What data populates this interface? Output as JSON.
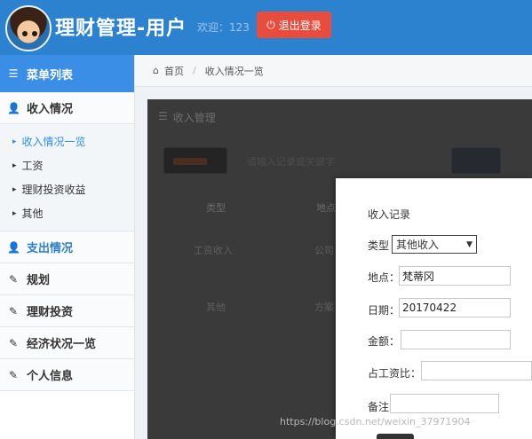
{
  "header": {
    "app_title": "理财管理-用户",
    "welcome": "欢迎：123",
    "logout_label": "退出登录",
    "bg_color": "#2d82cf",
    "logout_color": "#e74c3c"
  },
  "sidebar": {
    "menu_title": "菜单列表",
    "sections": [
      {
        "label": "收入情况",
        "icon": "user-icon"
      },
      {
        "label": "支出情况",
        "icon": "user-icon"
      },
      {
        "label": "规划",
        "icon": "edit-icon"
      },
      {
        "label": "理财投资",
        "icon": "edit-icon"
      },
      {
        "label": "经济状况一览",
        "icon": "edit-icon"
      },
      {
        "label": "个人信息",
        "icon": "edit-icon"
      }
    ],
    "income_sub": [
      "收入情况一览",
      "工资",
      "理财投资收益",
      "其他"
    ]
  },
  "breadcrumb": {
    "home": "首页",
    "current": "收入情况一览"
  },
  "panel": {
    "title": "收入管理",
    "search_hint": "请输入记录或关键字",
    "columns": [
      "类型",
      "地点"
    ],
    "rows": [
      [
        "工资收入",
        "公司"
      ],
      [
        "其他",
        "方案"
      ]
    ]
  },
  "dialog": {
    "title": "收入记录",
    "type_label": "类型",
    "type_value": "其他收入",
    "location_label": "地点：",
    "location_value": "梵蒂冈",
    "date_label": "日期：",
    "date_value": "20170422",
    "amount_label": "金额：",
    "amount_value": "",
    "ratio_label": "占工资比：",
    "ratio_value": "",
    "note_label": "备注",
    "note_value": ""
  },
  "watermark": "https://blog.csdn.net/weixin_37971904"
}
